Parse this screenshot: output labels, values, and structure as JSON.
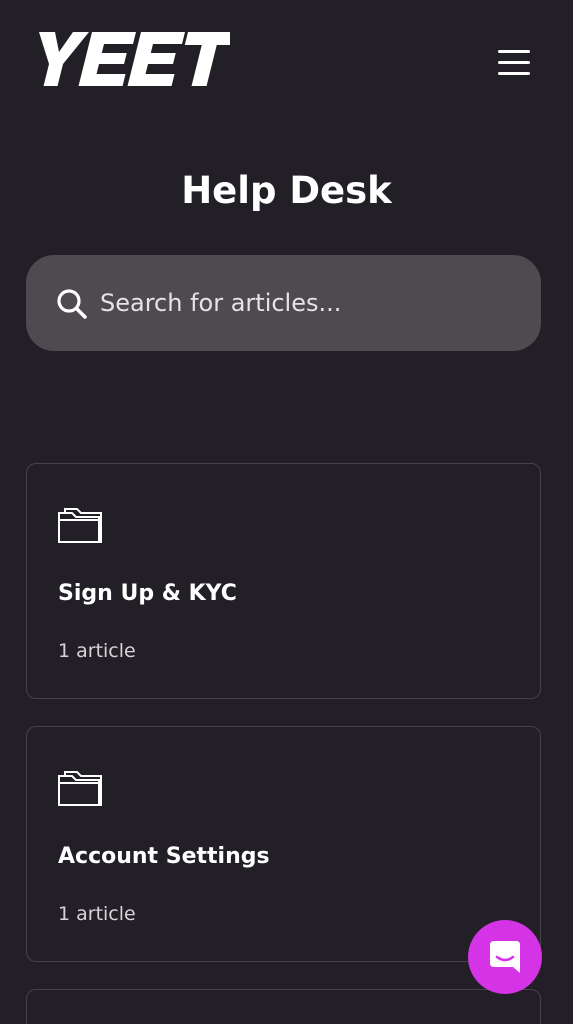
{
  "header": {
    "logo_text": "YEET",
    "menu_icon": "hamburger-menu-icon"
  },
  "main": {
    "title": "Help Desk",
    "search": {
      "placeholder": "Search for articles...",
      "value": "",
      "icon": "search-icon"
    },
    "collections": [
      {
        "title": "Sign Up & KYC",
        "count": "1 article",
        "icon": "folder-icon"
      },
      {
        "title": "Account Settings",
        "count": "1 article",
        "icon": "folder-icon"
      }
    ]
  },
  "chat_launcher": {
    "icon": "chat-bubble-icon",
    "color": "#d533e6"
  },
  "colors": {
    "background": "#231f26",
    "search_background": "#4e4a50",
    "card_border": "#46414a",
    "accent": "#d533e6"
  }
}
